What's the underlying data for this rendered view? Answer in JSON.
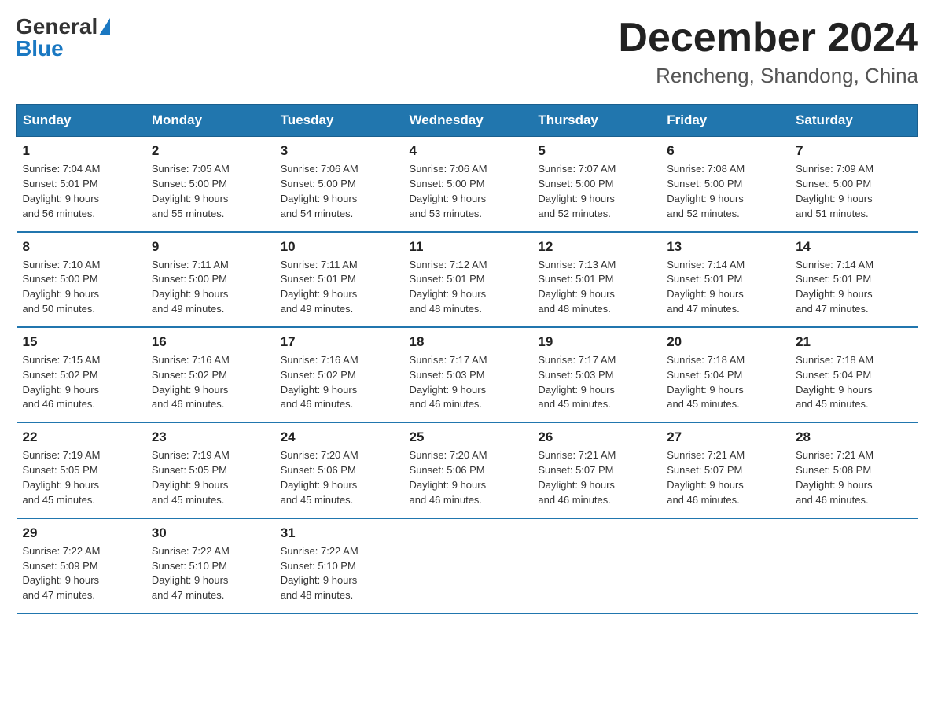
{
  "header": {
    "logo_general": "General",
    "logo_blue": "Blue",
    "month_title": "December 2024",
    "location": "Rencheng, Shandong, China"
  },
  "days_of_week": [
    "Sunday",
    "Monday",
    "Tuesday",
    "Wednesday",
    "Thursday",
    "Friday",
    "Saturday"
  ],
  "weeks": [
    [
      {
        "day": "1",
        "sunrise": "7:04 AM",
        "sunset": "5:01 PM",
        "daylight": "9 hours and 56 minutes."
      },
      {
        "day": "2",
        "sunrise": "7:05 AM",
        "sunset": "5:00 PM",
        "daylight": "9 hours and 55 minutes."
      },
      {
        "day": "3",
        "sunrise": "7:06 AM",
        "sunset": "5:00 PM",
        "daylight": "9 hours and 54 minutes."
      },
      {
        "day": "4",
        "sunrise": "7:06 AM",
        "sunset": "5:00 PM",
        "daylight": "9 hours and 53 minutes."
      },
      {
        "day": "5",
        "sunrise": "7:07 AM",
        "sunset": "5:00 PM",
        "daylight": "9 hours and 52 minutes."
      },
      {
        "day": "6",
        "sunrise": "7:08 AM",
        "sunset": "5:00 PM",
        "daylight": "9 hours and 52 minutes."
      },
      {
        "day": "7",
        "sunrise": "7:09 AM",
        "sunset": "5:00 PM",
        "daylight": "9 hours and 51 minutes."
      }
    ],
    [
      {
        "day": "8",
        "sunrise": "7:10 AM",
        "sunset": "5:00 PM",
        "daylight": "9 hours and 50 minutes."
      },
      {
        "day": "9",
        "sunrise": "7:11 AM",
        "sunset": "5:00 PM",
        "daylight": "9 hours and 49 minutes."
      },
      {
        "day": "10",
        "sunrise": "7:11 AM",
        "sunset": "5:01 PM",
        "daylight": "9 hours and 49 minutes."
      },
      {
        "day": "11",
        "sunrise": "7:12 AM",
        "sunset": "5:01 PM",
        "daylight": "9 hours and 48 minutes."
      },
      {
        "day": "12",
        "sunrise": "7:13 AM",
        "sunset": "5:01 PM",
        "daylight": "9 hours and 48 minutes."
      },
      {
        "day": "13",
        "sunrise": "7:14 AM",
        "sunset": "5:01 PM",
        "daylight": "9 hours and 47 minutes."
      },
      {
        "day": "14",
        "sunrise": "7:14 AM",
        "sunset": "5:01 PM",
        "daylight": "9 hours and 47 minutes."
      }
    ],
    [
      {
        "day": "15",
        "sunrise": "7:15 AM",
        "sunset": "5:02 PM",
        "daylight": "9 hours and 46 minutes."
      },
      {
        "day": "16",
        "sunrise": "7:16 AM",
        "sunset": "5:02 PM",
        "daylight": "9 hours and 46 minutes."
      },
      {
        "day": "17",
        "sunrise": "7:16 AM",
        "sunset": "5:02 PM",
        "daylight": "9 hours and 46 minutes."
      },
      {
        "day": "18",
        "sunrise": "7:17 AM",
        "sunset": "5:03 PM",
        "daylight": "9 hours and 46 minutes."
      },
      {
        "day": "19",
        "sunrise": "7:17 AM",
        "sunset": "5:03 PM",
        "daylight": "9 hours and 45 minutes."
      },
      {
        "day": "20",
        "sunrise": "7:18 AM",
        "sunset": "5:04 PM",
        "daylight": "9 hours and 45 minutes."
      },
      {
        "day": "21",
        "sunrise": "7:18 AM",
        "sunset": "5:04 PM",
        "daylight": "9 hours and 45 minutes."
      }
    ],
    [
      {
        "day": "22",
        "sunrise": "7:19 AM",
        "sunset": "5:05 PM",
        "daylight": "9 hours and 45 minutes."
      },
      {
        "day": "23",
        "sunrise": "7:19 AM",
        "sunset": "5:05 PM",
        "daylight": "9 hours and 45 minutes."
      },
      {
        "day": "24",
        "sunrise": "7:20 AM",
        "sunset": "5:06 PM",
        "daylight": "9 hours and 45 minutes."
      },
      {
        "day": "25",
        "sunrise": "7:20 AM",
        "sunset": "5:06 PM",
        "daylight": "9 hours and 46 minutes."
      },
      {
        "day": "26",
        "sunrise": "7:21 AM",
        "sunset": "5:07 PM",
        "daylight": "9 hours and 46 minutes."
      },
      {
        "day": "27",
        "sunrise": "7:21 AM",
        "sunset": "5:07 PM",
        "daylight": "9 hours and 46 minutes."
      },
      {
        "day": "28",
        "sunrise": "7:21 AM",
        "sunset": "5:08 PM",
        "daylight": "9 hours and 46 minutes."
      }
    ],
    [
      {
        "day": "29",
        "sunrise": "7:22 AM",
        "sunset": "5:09 PM",
        "daylight": "9 hours and 47 minutes."
      },
      {
        "day": "30",
        "sunrise": "7:22 AM",
        "sunset": "5:10 PM",
        "daylight": "9 hours and 47 minutes."
      },
      {
        "day": "31",
        "sunrise": "7:22 AM",
        "sunset": "5:10 PM",
        "daylight": "9 hours and 48 minutes."
      },
      null,
      null,
      null,
      null
    ]
  ],
  "labels": {
    "sunrise": "Sunrise:",
    "sunset": "Sunset:",
    "daylight": "Daylight:"
  }
}
